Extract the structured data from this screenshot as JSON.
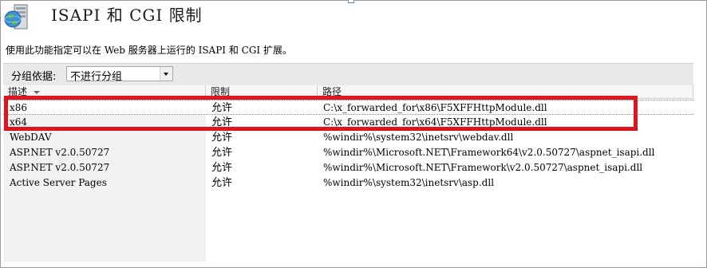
{
  "header": {
    "title": "ISAPI 和 CGI 限制",
    "icon": "globe-server-icon"
  },
  "description": "使用此功能指定可以在 Web 服务器上运行的 ISAPI 和 CGI 扩展。",
  "groupby": {
    "label": "分组依据:",
    "selected": "不进行分组"
  },
  "columns": {
    "name": "描述",
    "restriction": "限制",
    "path": "路径"
  },
  "rows": [
    {
      "name": "x86",
      "restriction": "允许",
      "path": "C:\\x_forwarded_for\\x86\\F5XFFHttpModule.dll"
    },
    {
      "name": "x64",
      "restriction": "允许",
      "path": "C:\\x_forwarded_for\\x64\\F5XFFHttpModule.dll"
    },
    {
      "name": "WebDAV",
      "restriction": "允许",
      "path": "%windir%\\system32\\inetsrv\\webdav.dll"
    },
    {
      "name": "ASP.NET v2.0.50727",
      "restriction": "允许",
      "path": "%windir%\\Microsoft.NET\\Framework64\\v2.0.50727\\aspnet_isapi.dll"
    },
    {
      "name": "ASP.NET v2.0.50727",
      "restriction": "允许",
      "path": "%windir%\\Microsoft.NET\\Framework\\v2.0.50727\\aspnet_isapi.dll"
    },
    {
      "name": "Active Server Pages",
      "restriction": "允许",
      "path": "%windir%\\system32\\inetsrv\\asp.dll"
    }
  ],
  "colors": {
    "highlight_box": "#e0141e",
    "groupbar_bg": "#e9e9e9",
    "left_pane_bg": "#f2f2f2"
  }
}
